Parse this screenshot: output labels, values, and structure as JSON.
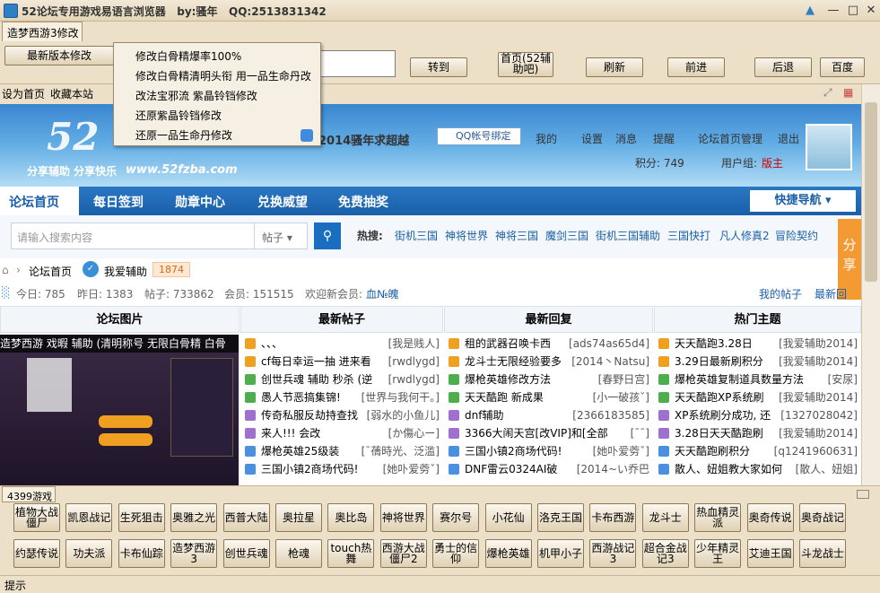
{
  "window": {
    "title": "52论坛专用游戏易语言浏览器",
    "author": "by:骚年",
    "qq": "QQ:2513831342"
  },
  "tabs": [
    "造梦西游3修改"
  ],
  "toolbar": {
    "latest_mod": "最新版本修改",
    "go": "转到",
    "home": "首页(52辅助吧)",
    "refresh": "刷新",
    "forward": "前进",
    "back": "后退",
    "baidu": "百度"
  },
  "dropdown_menu": [
    "修改白骨精爆率100%",
    "修改白骨精清明头衔 用一品生命丹改",
    "改法宝邪流 紫晶铃铛修改",
    "还原紫晶铃铛修改",
    "还原一品生命丹修改"
  ],
  "links": {
    "set_home": "设为首页",
    "bookmark": "收藏本站"
  },
  "site": {
    "logo": "52",
    "slogan": "分享辅助  分享快乐",
    "domain": "www.52fzba.com",
    "welcome": "2014骚年求超越",
    "qq_bind": "QQ帐号绑定",
    "user_links": [
      "我的",
      "设置",
      "消息",
      "提醒",
      "论坛首页管理",
      "退出"
    ],
    "points": "积分: 749",
    "group_label": "用户组:",
    "group": "版主"
  },
  "nav": {
    "items": [
      "论坛首页",
      "每日签到",
      "勋章中心",
      "兑换威望",
      "免费抽奖"
    ],
    "quick": "快捷导航"
  },
  "search": {
    "placeholder": "请输入搜索内容",
    "scope": "帖子",
    "hot_label": "热搜:",
    "hot": [
      "街机三国",
      "神将世界",
      "神将三国",
      "魔剑三国",
      "街机三国辅助",
      "三国快打",
      "凡人修真2",
      "冒险契约"
    ]
  },
  "share": "分享",
  "breadcrumb": {
    "home": "论坛首页",
    "site": "我爱辅助",
    "count": "1874"
  },
  "stats": {
    "today": "今日: 785",
    "yesterday": "昨日: 1383",
    "posts": "帖子: 733862",
    "members": "会员: 151515",
    "welcome": "欢迎新会员:",
    "new_member": "血№魄",
    "my_posts": "我的帖子",
    "latest": "最新回"
  },
  "columns": {
    "pics": "论坛图片",
    "new_posts": "最新帖子",
    "new_replies": "最新回复",
    "hot": "热门主题"
  },
  "pic_caption": "造梦西游 戏暇 辅助 (清明称号 无限白骨精 白骨",
  "new_posts": [
    {
      "t": "、、、",
      "a": "[我是贱人]",
      "c": "#f0a020"
    },
    {
      "t": "cf每日幸运一抽 进来看",
      "a": "[rwdlygd]",
      "c": "#f0a020"
    },
    {
      "t": "创世兵魂 辅助 秒杀 (逆",
      "a": "[rwdlygd]",
      "c": "#4cae4c"
    },
    {
      "t": "愚人节恶搞集锦!",
      "a": "[世界与我何干。]",
      "c": "#4cae4c"
    },
    {
      "t": "传奇私服反劫持查找",
      "a": "[弱水的小鱼儿]",
      "c": "#a070d0"
    },
    {
      "t": "来人!!! 会改",
      "a": "[か傷心ー]",
      "c": "#a070d0"
    },
    {
      "t": "爆枪英雄25级装",
      "a": "[ˉ蒨時光、泛滥]",
      "c": "#4a90e0"
    },
    {
      "t": "三国小镇2商场代码!",
      "a": "[她卟爱䓖ˇ]",
      "c": "#4a90e0"
    }
  ],
  "new_replies": [
    {
      "t": "租的武器召唤卡西",
      "a": "[ads74as65d4]",
      "c": "#f0a020"
    },
    {
      "t": "龙斗士无限经验要多",
      "a": "[2014丶Natsu]",
      "c": "#f0a020"
    },
    {
      "t": "爆枪英雄修改方法",
      "a": "[春野日宫]",
      "c": "#4cae4c"
    },
    {
      "t": "天天酷跑 新成果",
      "a": "[小一破孩ˇ]",
      "c": "#4cae4c"
    },
    {
      "t": "dnf辅助",
      "a": "[2366183585]",
      "c": "#a070d0"
    },
    {
      "t": "3366大闹天宫[改VIP]和[全部",
      "a": "[ˉˉ]",
      "c": "#a070d0"
    },
    {
      "t": "三国小镇2商场代码!",
      "a": "[她卟爱䓖ˇ]",
      "c": "#4a90e0"
    },
    {
      "t": "DNF雷云0324AI破",
      "a": "[2014~い乔巴",
      "c": "#4a90e0"
    }
  ],
  "hot_topics": [
    {
      "t": "天天酷跑3.28日",
      "a": "[我爱辅助2014]",
      "c": "#f0a020"
    },
    {
      "t": "3.29日最新刷积分",
      "a": "[我爱辅助2014]",
      "c": "#f0a020"
    },
    {
      "t": "爆枪英雄复制道具数量方法",
      "a": "[安尿]",
      "c": "#4cae4c"
    },
    {
      "t": "天天酷跑XP系统刷",
      "a": "[我爱辅助2014]",
      "c": "#4cae4c"
    },
    {
      "t": "XP系统刷分成功, 还",
      "a": "[1327028042]",
      "c": "#a070d0"
    },
    {
      "t": "3.28日天天酷跑刷",
      "a": "[我爱辅助2014]",
      "c": "#a070d0"
    },
    {
      "t": "天天酷跑刷积分",
      "a": "[q1241960631]",
      "c": "#4a90e0"
    },
    {
      "t": "散人、妞姐教大家如何",
      "a": "[散人、妞姐]",
      "c": "#4a90e0"
    }
  ],
  "bottom_tab": "4399游戏",
  "games_row1": [
    "植物大战僵尸",
    "凯恩战记",
    "生死狙击",
    "奥雅之光",
    "西普大陆",
    "奥拉星",
    "奥比岛",
    "神将世界",
    "赛尔号",
    "小花仙",
    "洛克王国",
    "卡布西游",
    "龙斗士",
    "热血精灵派",
    "奥奇传说",
    "奥奇战记"
  ],
  "games_row2": [
    "约瑟传说",
    "功夫派",
    "卡布仙踪",
    "造梦西游3",
    "创世兵魂",
    "枪魂",
    "touch热舞",
    "西游大战僵尸2",
    "勇士的信仰",
    "爆枪英雄",
    "机甲小子",
    "西游战记3",
    "超合金战记3",
    "少年精灵王",
    "艾迪王国",
    "斗龙战士"
  ],
  "status": "提示"
}
